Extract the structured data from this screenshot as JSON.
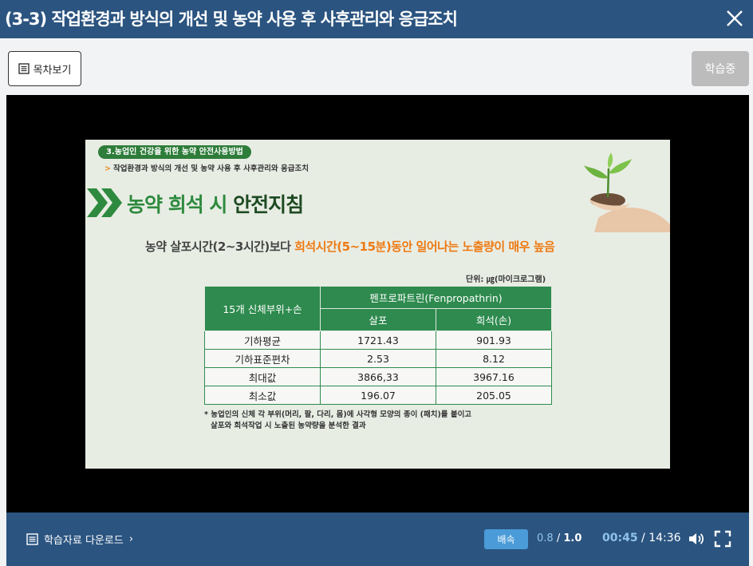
{
  "window": {
    "title": "(3-3) 작업환경과 방식의 개선 및 농약 사용 후 사후관리와 응급조치",
    "close_icon": "close-icon"
  },
  "toolbar": {
    "toc_label": "목차보기",
    "status_label": "학습중"
  },
  "slide": {
    "section": "3.농업인 건강을 위한 농약 안전사용방법",
    "subheading": "작업환경과 방식의 개선 및 농약 사용 후 사후관리와 응급조치",
    "headline_light": "농약 희석 시 ",
    "headline_dark": "안전지침",
    "sentence_normal": "농약 살포시간(2~3시간)보다 ",
    "sentence_highlight": "희석시간(5~15분)동안 일어나는 노출량이 매우 높음",
    "unit": "단위: ㎍(마이크로그램)",
    "table": {
      "corner_header": "15개 신체부위+손",
      "group_header": "펜프로파트린(Fenpropathrin)",
      "col_headers": [
        "살포",
        "희석(손)"
      ],
      "rows": [
        {
          "label": "기하평균",
          "v1": "1721.43",
          "v2": "901.93"
        },
        {
          "label": "기하표준편차",
          "v1": "2.53",
          "v2": "8.12"
        },
        {
          "label": "최대값",
          "v1": "3866,33",
          "v2": "3967.16"
        },
        {
          "label": "최소값",
          "v1": "196.07",
          "v2": "205.05"
        }
      ]
    },
    "footnote_line1": "* 농업인의 신체 각 부위(머리, 팔, 다리, 몸)에 사각형 모양의 종이 (패치)를 붙이고",
    "footnote_line2": "살포와 희석작업 시 노출된 농약량을 분석한 결과",
    "colors": {
      "green": "#2e8a3e",
      "orange": "#ee7a12"
    }
  },
  "controls": {
    "download_label": "학습자료 다운로드",
    "download_arrow": "›",
    "speed_button": "배속",
    "speed_current": "0.8",
    "speed_sep": "/",
    "speed_selected": "1.0",
    "time_current": "00:45",
    "time_sep": "/",
    "time_total": "14:36"
  },
  "colors": {
    "header_bg": "#2b5480",
    "accent": "#4a9bd8"
  }
}
